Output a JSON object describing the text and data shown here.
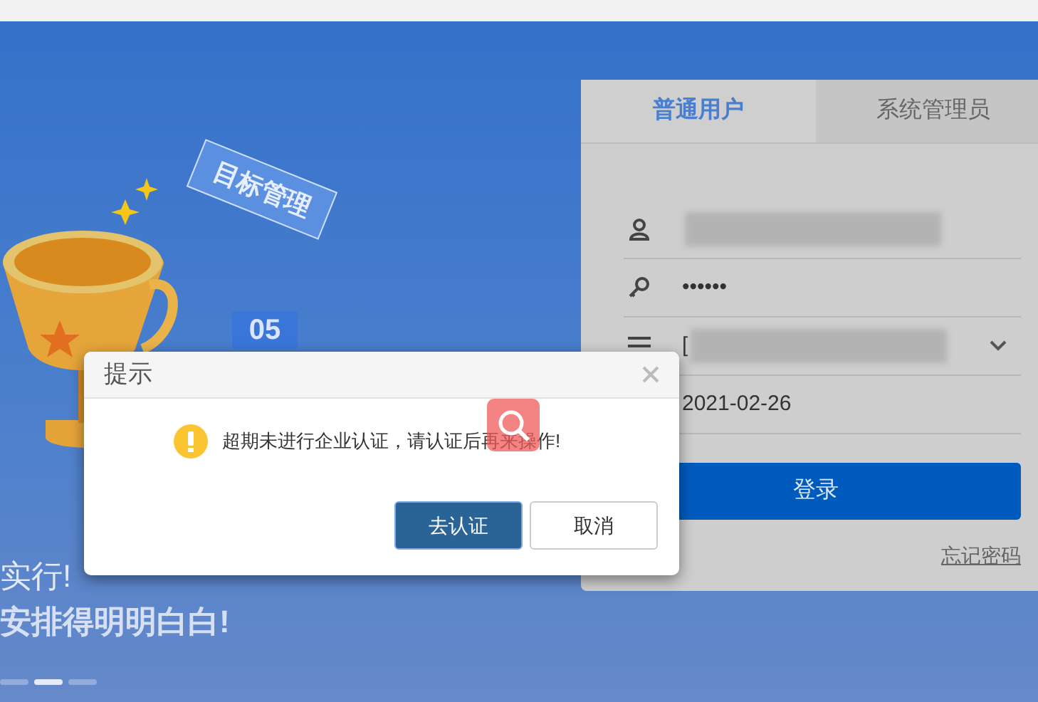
{
  "illustration": {
    "tag": "目标管理",
    "calendar": "05"
  },
  "slogans": [
    "实行!",
    "安排得明明白白!"
  ],
  "carousel_dots": [
    {
      "selected": false
    },
    {
      "selected": true
    },
    {
      "selected": false
    }
  ],
  "tabs": [
    {
      "label": "普通用户",
      "selected": true
    },
    {
      "label": "系统管理员",
      "selected": false
    }
  ],
  "fields": [
    {
      "kind": "user",
      "redacted": true
    },
    {
      "kind": "password",
      "value": "••••••",
      "redacted": false
    },
    {
      "kind": "select",
      "value": "[",
      "redacted": true
    },
    {
      "kind": "date",
      "value": "2021-02-26",
      "redacted": false
    }
  ],
  "login_button": "登录",
  "forgot_link": "忘记密码",
  "dialog": {
    "title": "提示",
    "message": "超期未进行企业认证，请认证后再来操作!",
    "buttons": [
      {
        "label": "去认证",
        "kind": "primary"
      },
      {
        "label": "取消",
        "kind": "default"
      }
    ]
  }
}
